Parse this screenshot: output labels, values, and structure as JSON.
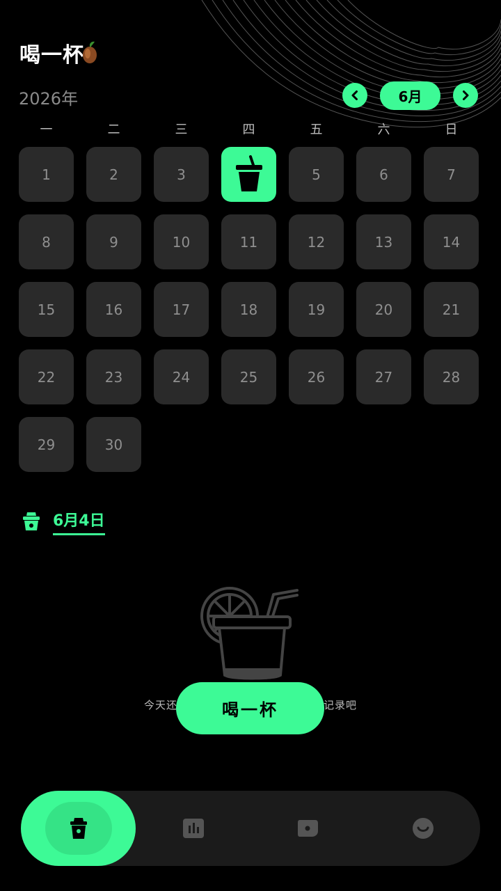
{
  "app": {
    "title": "喝一杯",
    "accent_color": "#3dfa96",
    "background_color": "#000000"
  },
  "calendar": {
    "year_label": "2026年",
    "month_label": "6月",
    "prev_icon": "chevron-left-icon",
    "next_icon": "chevron-right-icon",
    "weekdays": [
      "一",
      "二",
      "三",
      "四",
      "五",
      "六",
      "日"
    ],
    "days": [
      "1",
      "2",
      "3",
      "4",
      "5",
      "6",
      "7",
      "8",
      "9",
      "10",
      "11",
      "12",
      "13",
      "14",
      "15",
      "16",
      "17",
      "18",
      "19",
      "20",
      "21",
      "22",
      "23",
      "24",
      "25",
      "26",
      "27",
      "28",
      "29",
      "30"
    ],
    "selected_day": 4,
    "selected_day_icon": "drink-cup-icon"
  },
  "detail": {
    "date_label": "6月4日",
    "date_icon": "cup-icon",
    "empty_icon": "lemon-drink-icon",
    "empty_text_left": "今天还",
    "empty_text_right": "记录吧"
  },
  "action": {
    "drink_button_label": "喝一杯"
  },
  "bottom_nav": {
    "tabs": [
      {
        "icon": "cup-icon",
        "active": true
      },
      {
        "icon": "bar-chart-icon",
        "active": false
      },
      {
        "icon": "photo-icon",
        "active": false
      },
      {
        "icon": "smile-icon",
        "active": false
      }
    ]
  }
}
